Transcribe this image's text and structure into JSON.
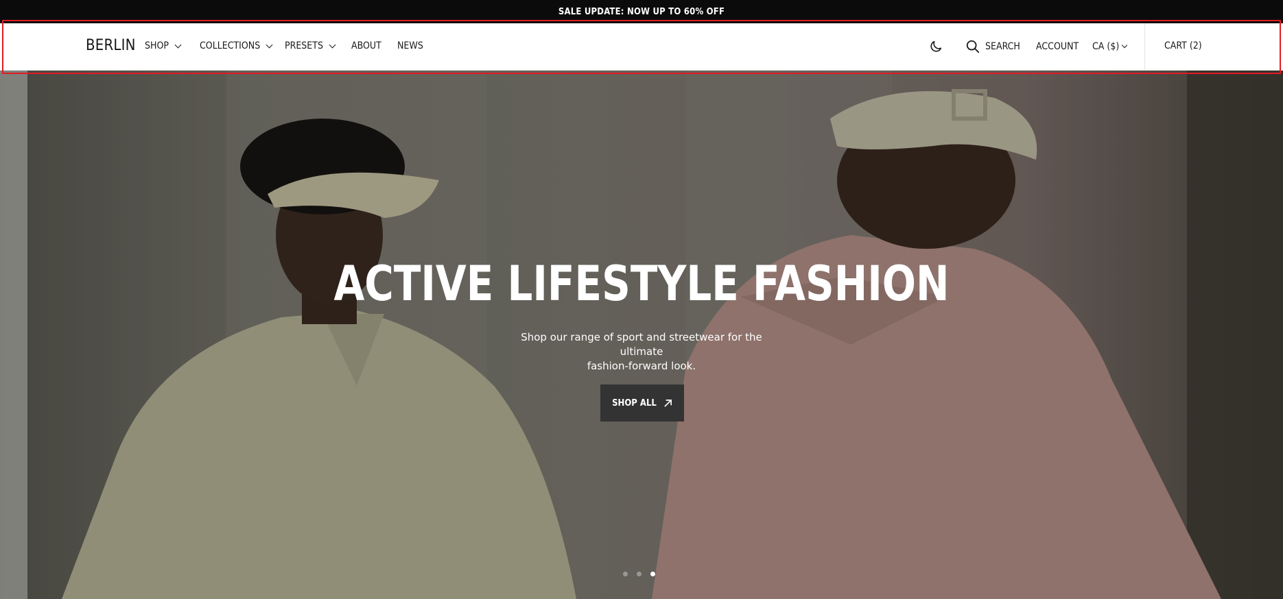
{
  "announcement": {
    "text": "SALE UPDATE: NOW UP TO 60% OFF"
  },
  "header": {
    "logo": "BERLIN",
    "nav": [
      {
        "label": "SHOP",
        "has_dropdown": true
      },
      {
        "label": "COLLECTIONS",
        "has_dropdown": true
      },
      {
        "label": "PRESETS",
        "has_dropdown": true
      },
      {
        "label": "ABOUT",
        "has_dropdown": false
      },
      {
        "label": "NEWS",
        "has_dropdown": false
      }
    ],
    "theme_toggle_icon": "moon-icon",
    "search_label": "SEARCH",
    "account_label": "ACCOUNT",
    "currency_label": "CA ($)",
    "cart_label": "CART (2)"
  },
  "hero": {
    "title": "ACTIVE LIFESTYLE FASHION",
    "subtitle_line1": "Shop our range of sport and streetwear for the ultimate",
    "subtitle_line2": "fashion-forward look.",
    "cta_label": "SHOP ALL",
    "cta_icon": "arrow-up-right-icon",
    "slides": {
      "count": 3,
      "active": 3
    }
  },
  "colors": {
    "announcement_bg": "#0b0b0b",
    "header_bg": "#ffffff",
    "cta_bg": "#333333",
    "highlight_frame": "#e01b24"
  }
}
